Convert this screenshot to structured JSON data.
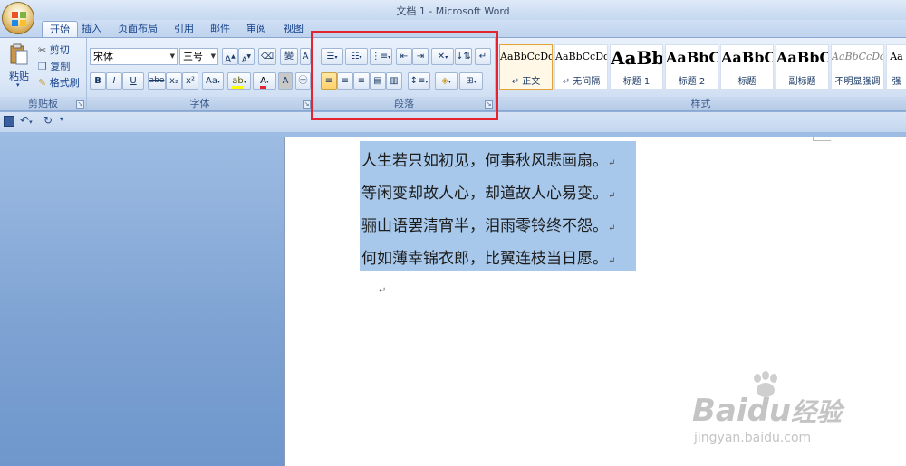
{
  "window": {
    "title": "文档 1 - Microsoft Word"
  },
  "tabs": [
    {
      "label": "开始",
      "active": true
    },
    {
      "label": "插入"
    },
    {
      "label": "页面布局"
    },
    {
      "label": "引用"
    },
    {
      "label": "邮件"
    },
    {
      "label": "审阅"
    },
    {
      "label": "视图"
    }
  ],
  "clipboard": {
    "label": "剪贴板",
    "paste": "粘贴",
    "cut": "剪切",
    "copy": "复制",
    "format_painter": "格式刷"
  },
  "font": {
    "label": "字体",
    "font_name": "宋体",
    "font_size": "三号",
    "bold": "B",
    "italic": "I",
    "underline": "U",
    "strikethrough": "abe",
    "subscript": "x₂",
    "superscript": "x²",
    "change_case": "Aa",
    "grow": "A",
    "shrink": "A",
    "font_color": "A",
    "char_shade": "A",
    "enclose": "㊀"
  },
  "paragraph": {
    "label": "段落"
  },
  "styles": {
    "label": "样式",
    "items": [
      {
        "sample": "AaBbCcDd",
        "name": "↵ 正文",
        "selected": true
      },
      {
        "sample": "AaBbCcDd",
        "name": "↵ 无间隔"
      },
      {
        "sample": "AaBb",
        "name": "标题 1"
      },
      {
        "sample": "AaBbC",
        "name": "标题 2"
      },
      {
        "sample": "AaBbC",
        "name": "标题"
      },
      {
        "sample": "AaBbC",
        "name": "副标题"
      },
      {
        "sample": "AaBbCcDd",
        "name": "不明显强调"
      },
      {
        "sample": "Aa",
        "name": "强"
      }
    ]
  },
  "document": {
    "lines": [
      "人生若只如初见，何事秋风悲画扇。",
      "等闲变却故人心，却道故人心易变。",
      "骊山语罢清宵半，泪雨零铃终不怨。",
      "何如薄幸锦衣郎，比翼连枝当日愿。"
    ],
    "paragraph_mark": "↵"
  },
  "watermark": {
    "brand": "Baidu",
    "cn": "经验",
    "url": "jingyan.baidu.com"
  },
  "colors": {
    "highlight": "#ffff00",
    "font_color": "#e3232d",
    "annotation": "#e3232d",
    "selection": "#a7c8ea"
  }
}
